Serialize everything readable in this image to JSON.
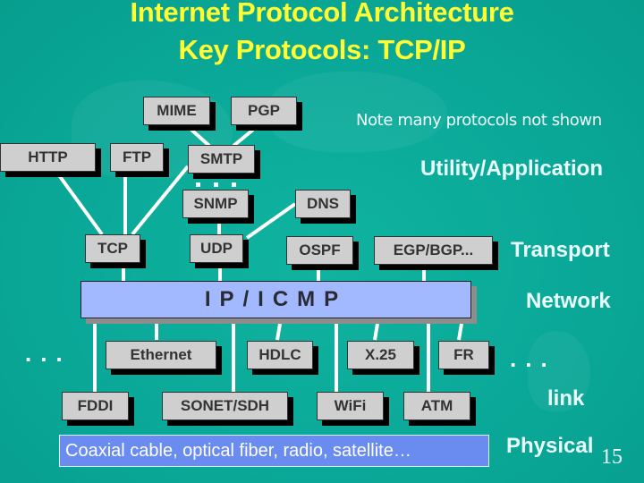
{
  "title": {
    "line1": "Internet Protocol Architecture",
    "line2": "Key Protocols: TCP/IP"
  },
  "note": "Note many protocols not shown",
  "colors": {
    "background": "#0aa898",
    "title": "#ffff33",
    "box": "#cfcfcf",
    "ip_bar": "#a3b9ff",
    "physical_bar": "#6a8cf0",
    "label": "#eaffff"
  },
  "layers": {
    "application": "Utility/Application",
    "transport": "Transport",
    "network": "Network",
    "link": "link",
    "physical": "Physical"
  },
  "boxes": {
    "mime": "MIME",
    "pgp": "PGP",
    "http": "HTTP",
    "ftp": "FTP",
    "smtp": "SMTP",
    "snmp": "SNMP",
    "dns": "DNS",
    "tcp": "TCP",
    "udp": "UDP",
    "ospf": "OSPF",
    "egp_bgp": "EGP/BGP...",
    "ethernet": "Ethernet",
    "hdlc": "HDLC",
    "x25": "X.25",
    "fr": "FR",
    "fddi": "FDDI",
    "sonet_sdh": "SONET/SDH",
    "wifi": "WiFi",
    "atm": "ATM"
  },
  "ip_icmp": "IP/ICMP",
  "physical_media": "Coaxial cable, optical fiber, radio, satellite…",
  "ellipsis": "...",
  "page_number": "15"
}
